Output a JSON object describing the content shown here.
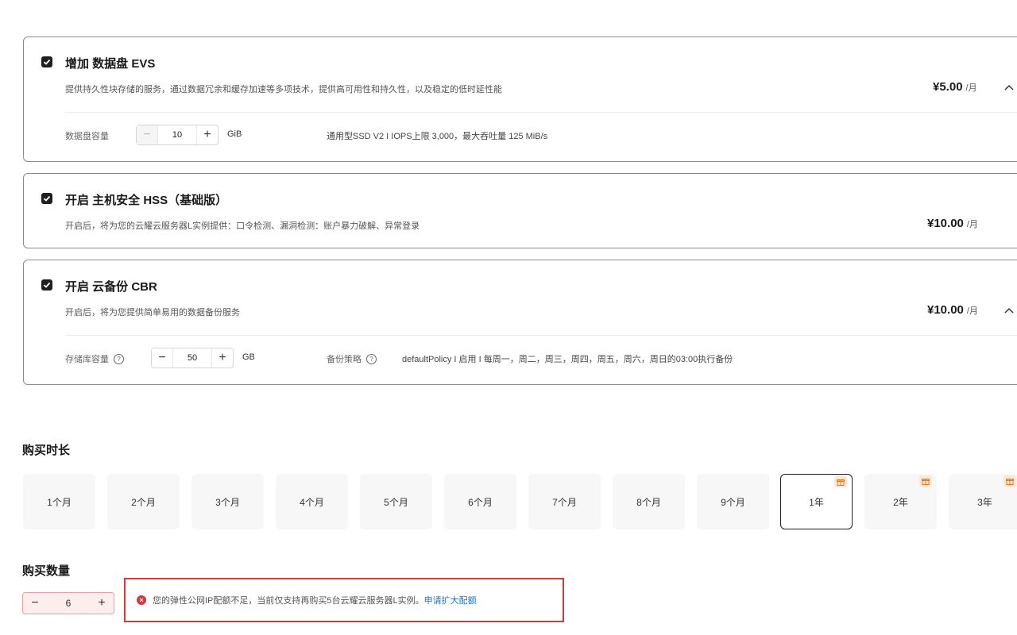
{
  "evs": {
    "title": "增加 数据盘 EVS",
    "desc": "提供持久性块存储的服务，通过数据冗余和缓存加速等多项技术，提供高可用性和持久性，以及稳定的低时延性能",
    "price": "¥5.00",
    "unit": "/月",
    "field_label": "数据盘容量",
    "minus": "−",
    "value": "10",
    "plus": "+",
    "value_unit": "GiB",
    "spec": "通用型SSD V2 I IOPS上限 3,000，最大吞吐量 125 MiB/s"
  },
  "hss": {
    "title": "开启 主机安全 HSS（基础版）",
    "desc": "开启后，将为您的云耀云服务器L实例提供：口令检测、漏洞检测：账户暴力破解、异常登录",
    "price": "¥10.00",
    "unit": "/月"
  },
  "cbr": {
    "title": "开启 云备份 CBR",
    "desc": "开启后，将为您提供简单易用的数据备份服务",
    "price": "¥10.00",
    "unit": "/月",
    "field_label": "存储库容量",
    "minus": "−",
    "value": "50",
    "plus": "+",
    "value_unit": "GB",
    "policy_label": "备份策略",
    "policy_value": "defaultPolicy I 启用 I 每周一，周二，周三，周四，周五，周六，周日的03:00执行备份"
  },
  "duration": {
    "title": "购买时长",
    "options": [
      {
        "label": "1个月"
      },
      {
        "label": "2个月"
      },
      {
        "label": "3个月"
      },
      {
        "label": "4个月"
      },
      {
        "label": "5个月"
      },
      {
        "label": "6个月"
      },
      {
        "label": "7个月"
      },
      {
        "label": "8个月"
      },
      {
        "label": "9个月"
      },
      {
        "label": "1年",
        "icon": "gift-icon"
      },
      {
        "label": "2年",
        "icon": "gift-icon"
      },
      {
        "label": "3年",
        "icon": "gift-icon"
      }
    ],
    "selected": "1年"
  },
  "quantity": {
    "title": "购买数量",
    "minus": "−",
    "value": "6",
    "plus": "+",
    "alert": "您的弹性公网IP配额不足，当前仅支持再购买5台云耀云服务器L实例。",
    "alert_link": "申请扩大配额"
  },
  "colors": {
    "error": "#d43a3a",
    "link": "#1f6fd1",
    "gift_bg": "#fde8d4"
  }
}
